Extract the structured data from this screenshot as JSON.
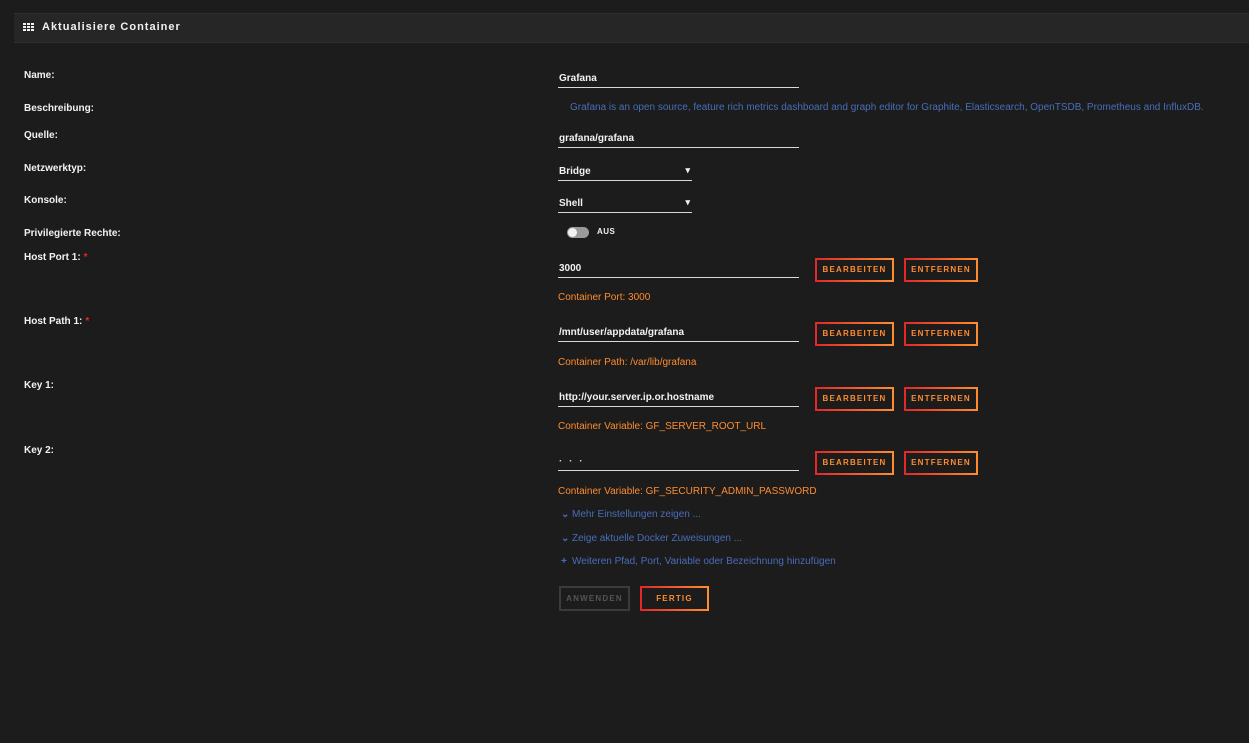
{
  "header": {
    "title": "Aktualisiere Container",
    "icon": "grid-icon"
  },
  "colors": {
    "background": "#1c1c1c",
    "accent_orange": "#ff8c2f",
    "accent_red": "#e22828",
    "link_blue": "#486dba"
  },
  "form": {
    "name_label": "Name:",
    "name_value": "Grafana",
    "description_label": "Beschreibung:",
    "description_value": "Grafana is an open source, feature rich metrics dashboard and graph editor for Graphite, Elasticsearch, OpenTSDB, Prometheus and InfluxDB.",
    "source_label": "Quelle:",
    "source_value": "grafana/grafana",
    "network_label": "Netzwerktyp:",
    "network_value": "Bridge",
    "console_label": "Konsole:",
    "console_value": "Shell",
    "privileged_label": "Privilegierte Rechte:",
    "privileged_state": "AUS",
    "required_mark": "*"
  },
  "port1": {
    "label": "Host Port 1:",
    "value": "3000",
    "hint": "Container Port: 3000"
  },
  "path1": {
    "label": "Host Path 1:",
    "value": "/mnt/user/appdata/grafana",
    "hint": "Container Path: /var/lib/grafana"
  },
  "key1": {
    "label": "Key 1:",
    "value": "http://your.server.ip.or.hostname",
    "hint": "Container Variable: GF_SERVER_ROOT_URL"
  },
  "key2": {
    "label": "Key 2:",
    "value": "·  ·    ·",
    "hint": "Container Variable: GF_SECURITY_ADMIN_PASSWORD"
  },
  "buttons": {
    "edit": "BEARBEITEN",
    "remove": "ENTFERNEN",
    "apply": "ANWENDEN",
    "done": "FERTIG"
  },
  "links": {
    "more_settings": "Mehr Einstellungen zeigen ...",
    "show_docker": "Zeige aktuelle Docker Zuweisungen ...",
    "add_more": "Weiteren Pfad, Port, Variable oder Bezeichnung hinzufügen"
  }
}
